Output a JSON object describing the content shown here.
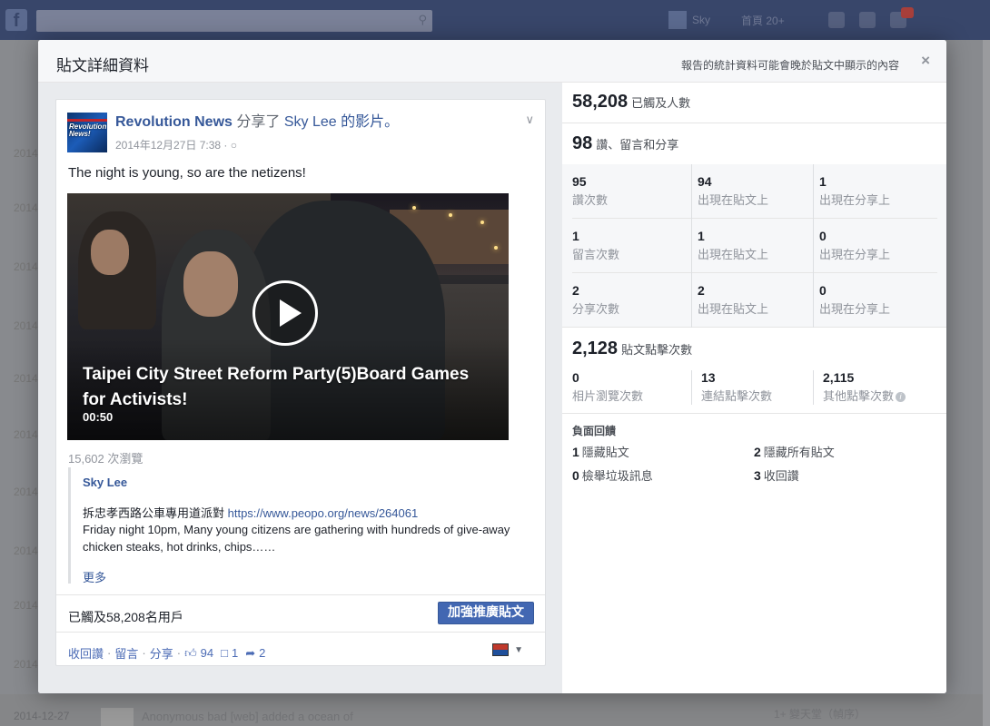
{
  "background": {
    "search_icon": "search-icon",
    "user_name": "Sky",
    "home_label": "首頁",
    "home_count": "20+",
    "side_dates": [
      "2014",
      "2014",
      "2014",
      "2014",
      "2014",
      "2014",
      "2014",
      "2014",
      "2014",
      "2014"
    ],
    "bottom_date": "2014-12-27",
    "bottom_text": "Anonymous bad [web] added a ocean of",
    "bottom_right": "1+ 變天堂（幀序）"
  },
  "dialog": {
    "title": "貼文詳細資料",
    "note": "報告的統計資料可能會晚於貼文中顯示的內容",
    "close_icon": "×"
  },
  "post": {
    "page_name": "Revolution News",
    "shared_prefix": "分享了",
    "shared_user": "Sky Lee",
    "shared_suffix": "的影片。",
    "avatar_text": "Revolution News!",
    "timestamp": "2014年12月27日 7:38 · ",
    "audience_icon": "globe-icon",
    "text": "The night is young, so are the netizens!",
    "video": {
      "title": "Taipei City Street Reform Party(5)Board Games for Activists!",
      "duration": "00:50"
    },
    "views": "15,602 次瀏覽",
    "quote": {
      "author": "Sky Lee",
      "line1_text": "拆忠孝西路公車專用道派對 ",
      "line1_link": "https://www.peopo.org/news/264061",
      "line2": "Friday night 10pm, Many young citizens are gathering with hundreds of give-away chicken steaks, hot drinks, chips……",
      "more": "更多"
    },
    "reach_text": "已觸及58,208名用戶",
    "boost_label": "加強推廣貼文",
    "actions": {
      "unlike": "收回讚",
      "comment": "留言",
      "share": "分享",
      "likes": "94",
      "comments": "1",
      "shares": "2"
    }
  },
  "stats": {
    "reach_num": "58,208",
    "reach_label": "已觸及人數",
    "engage_num": "98",
    "engage_label": "讚、留言和分享",
    "grid": [
      [
        {
          "num": "95",
          "label": "讚次數"
        },
        {
          "num": "94",
          "label": "出現在貼文上"
        },
        {
          "num": "1",
          "label": "出現在分享上"
        }
      ],
      [
        {
          "num": "1",
          "label": "留言次數"
        },
        {
          "num": "1",
          "label": "出現在貼文上"
        },
        {
          "num": "0",
          "label": "出現在分享上"
        }
      ],
      [
        {
          "num": "2",
          "label": "分享次數"
        },
        {
          "num": "2",
          "label": "出現在貼文上"
        },
        {
          "num": "0",
          "label": "出現在分享上"
        }
      ]
    ],
    "clicks_num": "2,128",
    "clicks_label": "貼文點擊次數",
    "clicks": [
      {
        "num": "0",
        "label": "相片瀏覽次數"
      },
      {
        "num": "13",
        "label": "連結點擊次數"
      },
      {
        "num": "2,115",
        "label": "其他點擊次數"
      }
    ],
    "negative_title": "負面回饋",
    "negative": [
      {
        "num": "1",
        "label": "隱藏貼文"
      },
      {
        "num": "2",
        "label": "隱藏所有貼文"
      },
      {
        "num": "0",
        "label": "檢舉垃圾訊息"
      },
      {
        "num": "3",
        "label": "收回讚"
      }
    ]
  }
}
